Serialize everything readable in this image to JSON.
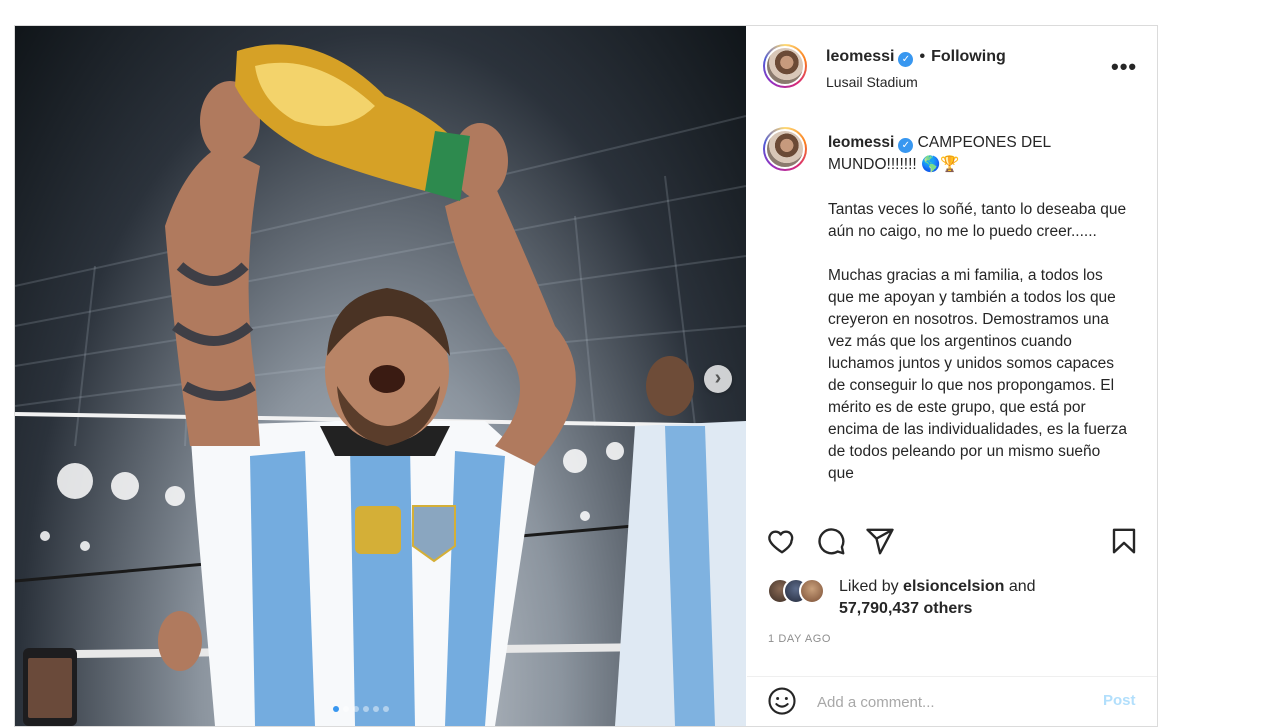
{
  "header": {
    "username": "leomessi",
    "separator": "•",
    "follow_status": "Following",
    "location": "Lusail Stadium",
    "more_icon": "more-horizontal-icon"
  },
  "caption": {
    "username": "leomessi",
    "title": "CAMPEONES DEL MUNDO!!!!!!! 🌎🏆",
    "paragraphs": [
      "Tantas veces lo soñé, tanto lo deseaba que aún no caigo, no me lo puedo creer......",
      "Muchas gracias a mi familia, a todos los que me apoyan y también a todos los que creyeron en nosotros. Demostramos una vez más que los argentinos cuando luchamos juntos y unidos somos capaces de conseguir lo que nos propongamos. El mérito es de este grupo, que está por encima de las individualidades, es la fuerza de todos peleando por un mismo sueño que"
    ]
  },
  "actions": {
    "icons": [
      "heart-icon",
      "comment-icon",
      "share-icon",
      "bookmark-icon"
    ]
  },
  "likes": {
    "prefix": "Liked by",
    "user": "elsioncelsion",
    "conjunction": "and",
    "others": "57,790,437 others"
  },
  "timestamp": "1 DAY AGO",
  "comment": {
    "placeholder": "Add a comment...",
    "post_label": "Post"
  },
  "carousel": {
    "next_icon": "chevron-right-icon",
    "slide_count": 6,
    "active_index": 0
  },
  "colors": {
    "accent": "#3897f0",
    "post_disabled": "#b2dffc",
    "muted": "#8e8e8e"
  }
}
